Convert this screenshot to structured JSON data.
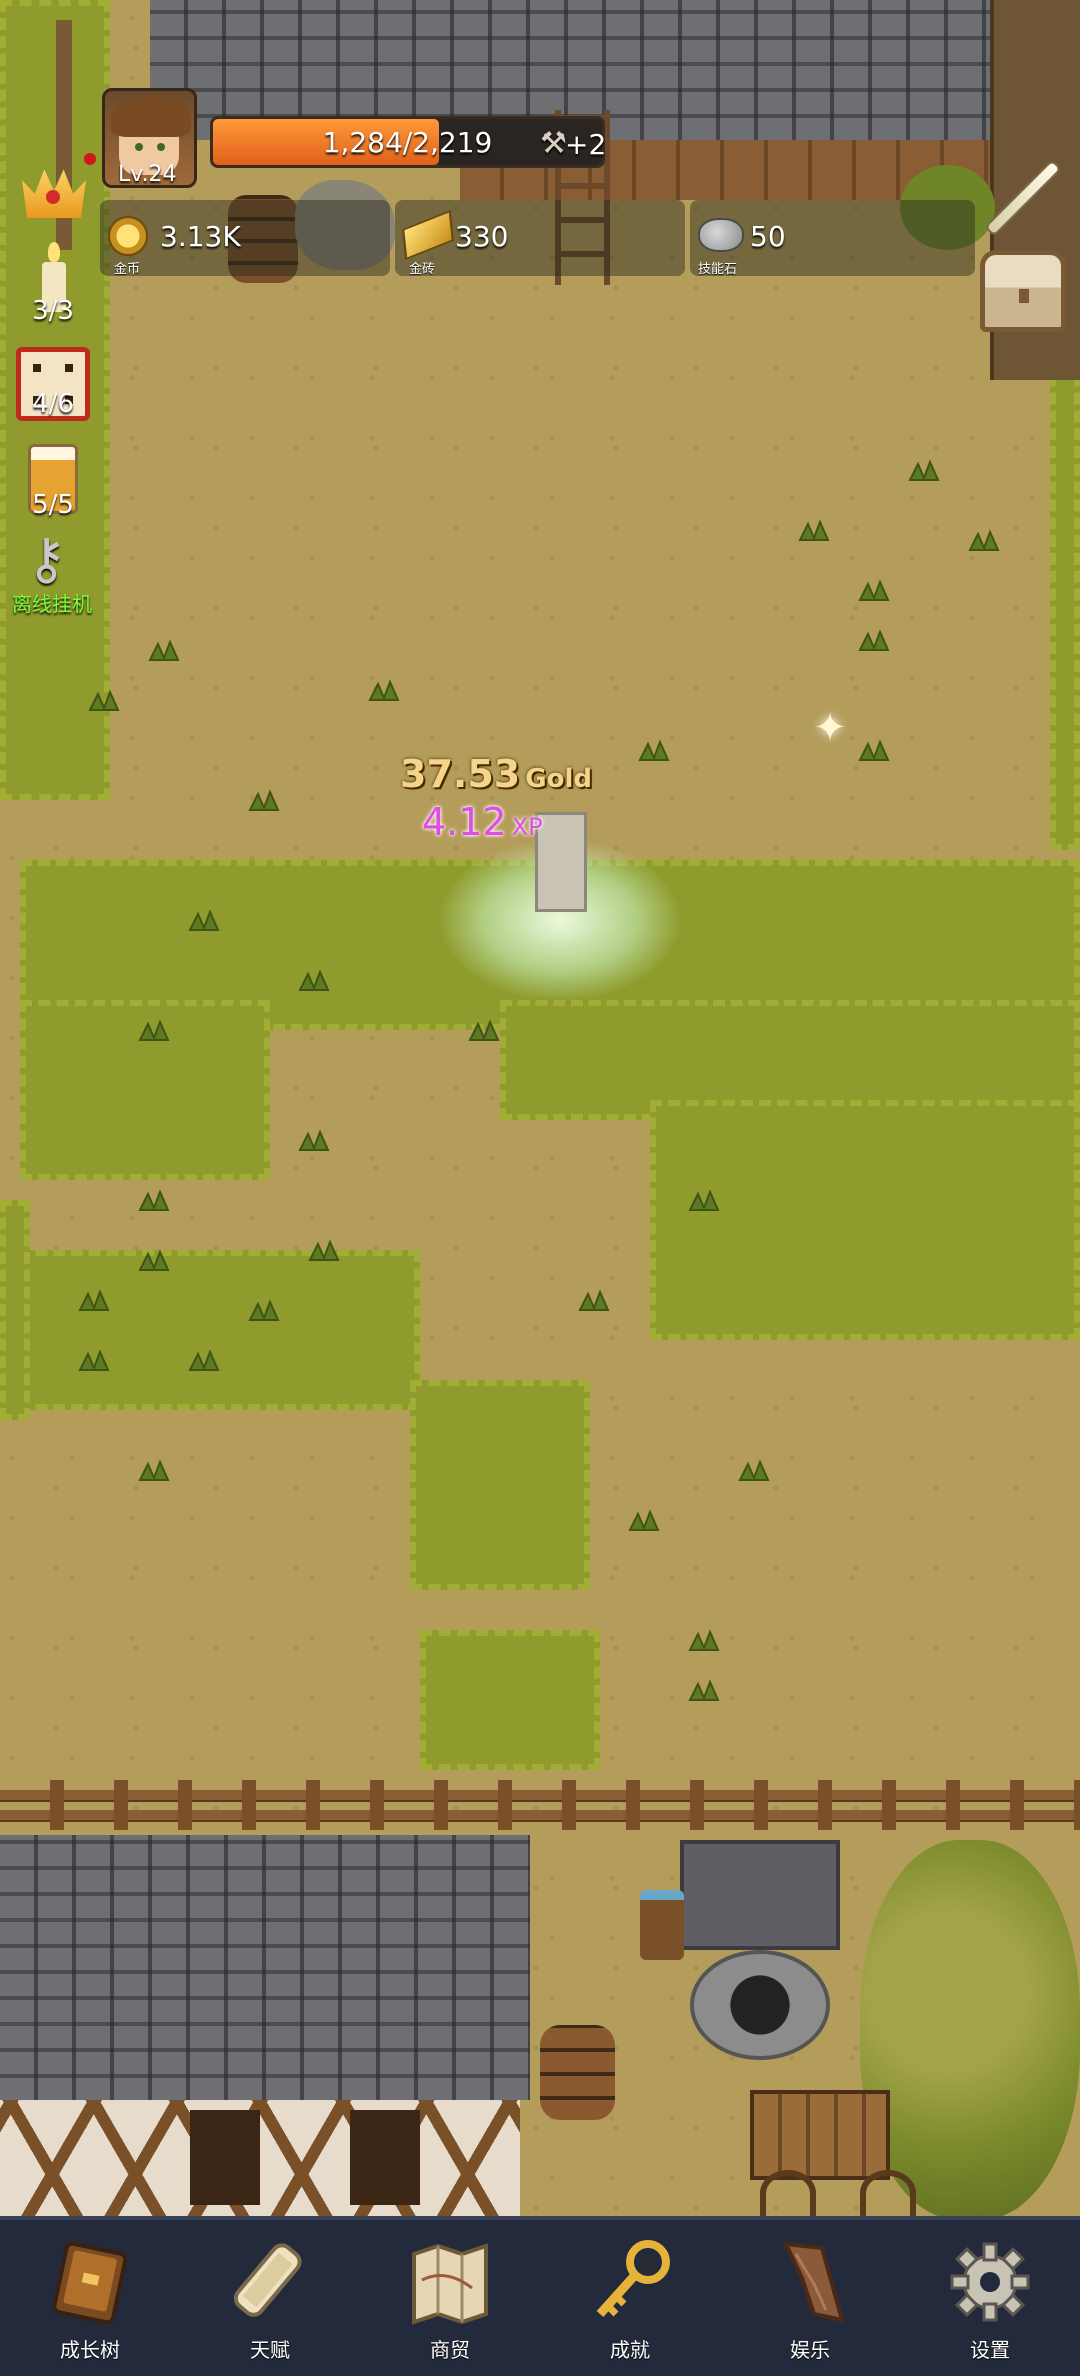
{
  "player": {
    "level_label": "Lv.24",
    "xp_text": "1,284/2,219",
    "xp_progress": 0.58,
    "xp_bonus": "+2"
  },
  "resources": [
    {
      "icon": "gold-coin-icon",
      "value": "3.13K",
      "label": "金币"
    },
    {
      "icon": "gold-bar-icon",
      "value": "330",
      "label": "金砖"
    },
    {
      "icon": "skill-stone-icon",
      "value": "50",
      "label": "技能石"
    }
  ],
  "side": {
    "candle_count": "3/3",
    "dice_count": "4/6",
    "beer_count": "5/5",
    "idle_label": "离线挂机"
  },
  "floating": {
    "gold_value": "37.53",
    "gold_unit": "Gold",
    "xp_value": "4.12",
    "xp_unit": "XP"
  },
  "nav": [
    {
      "icon": "book-icon",
      "label": "成长树"
    },
    {
      "icon": "scroll-icon",
      "label": "天赋"
    },
    {
      "icon": "map-icon",
      "label": "商贸"
    },
    {
      "icon": "key-icon",
      "label": "成就"
    },
    {
      "icon": "leaf-icon",
      "label": "娱乐"
    },
    {
      "icon": "gear-icon",
      "label": "设置"
    }
  ],
  "colors": {
    "xp_fill": "#e0601a",
    "nav_bg": "#232a3b",
    "idle_text": "#7bff3a",
    "xp_float": "#e04ce6",
    "gold_float": "#f6d58b"
  }
}
